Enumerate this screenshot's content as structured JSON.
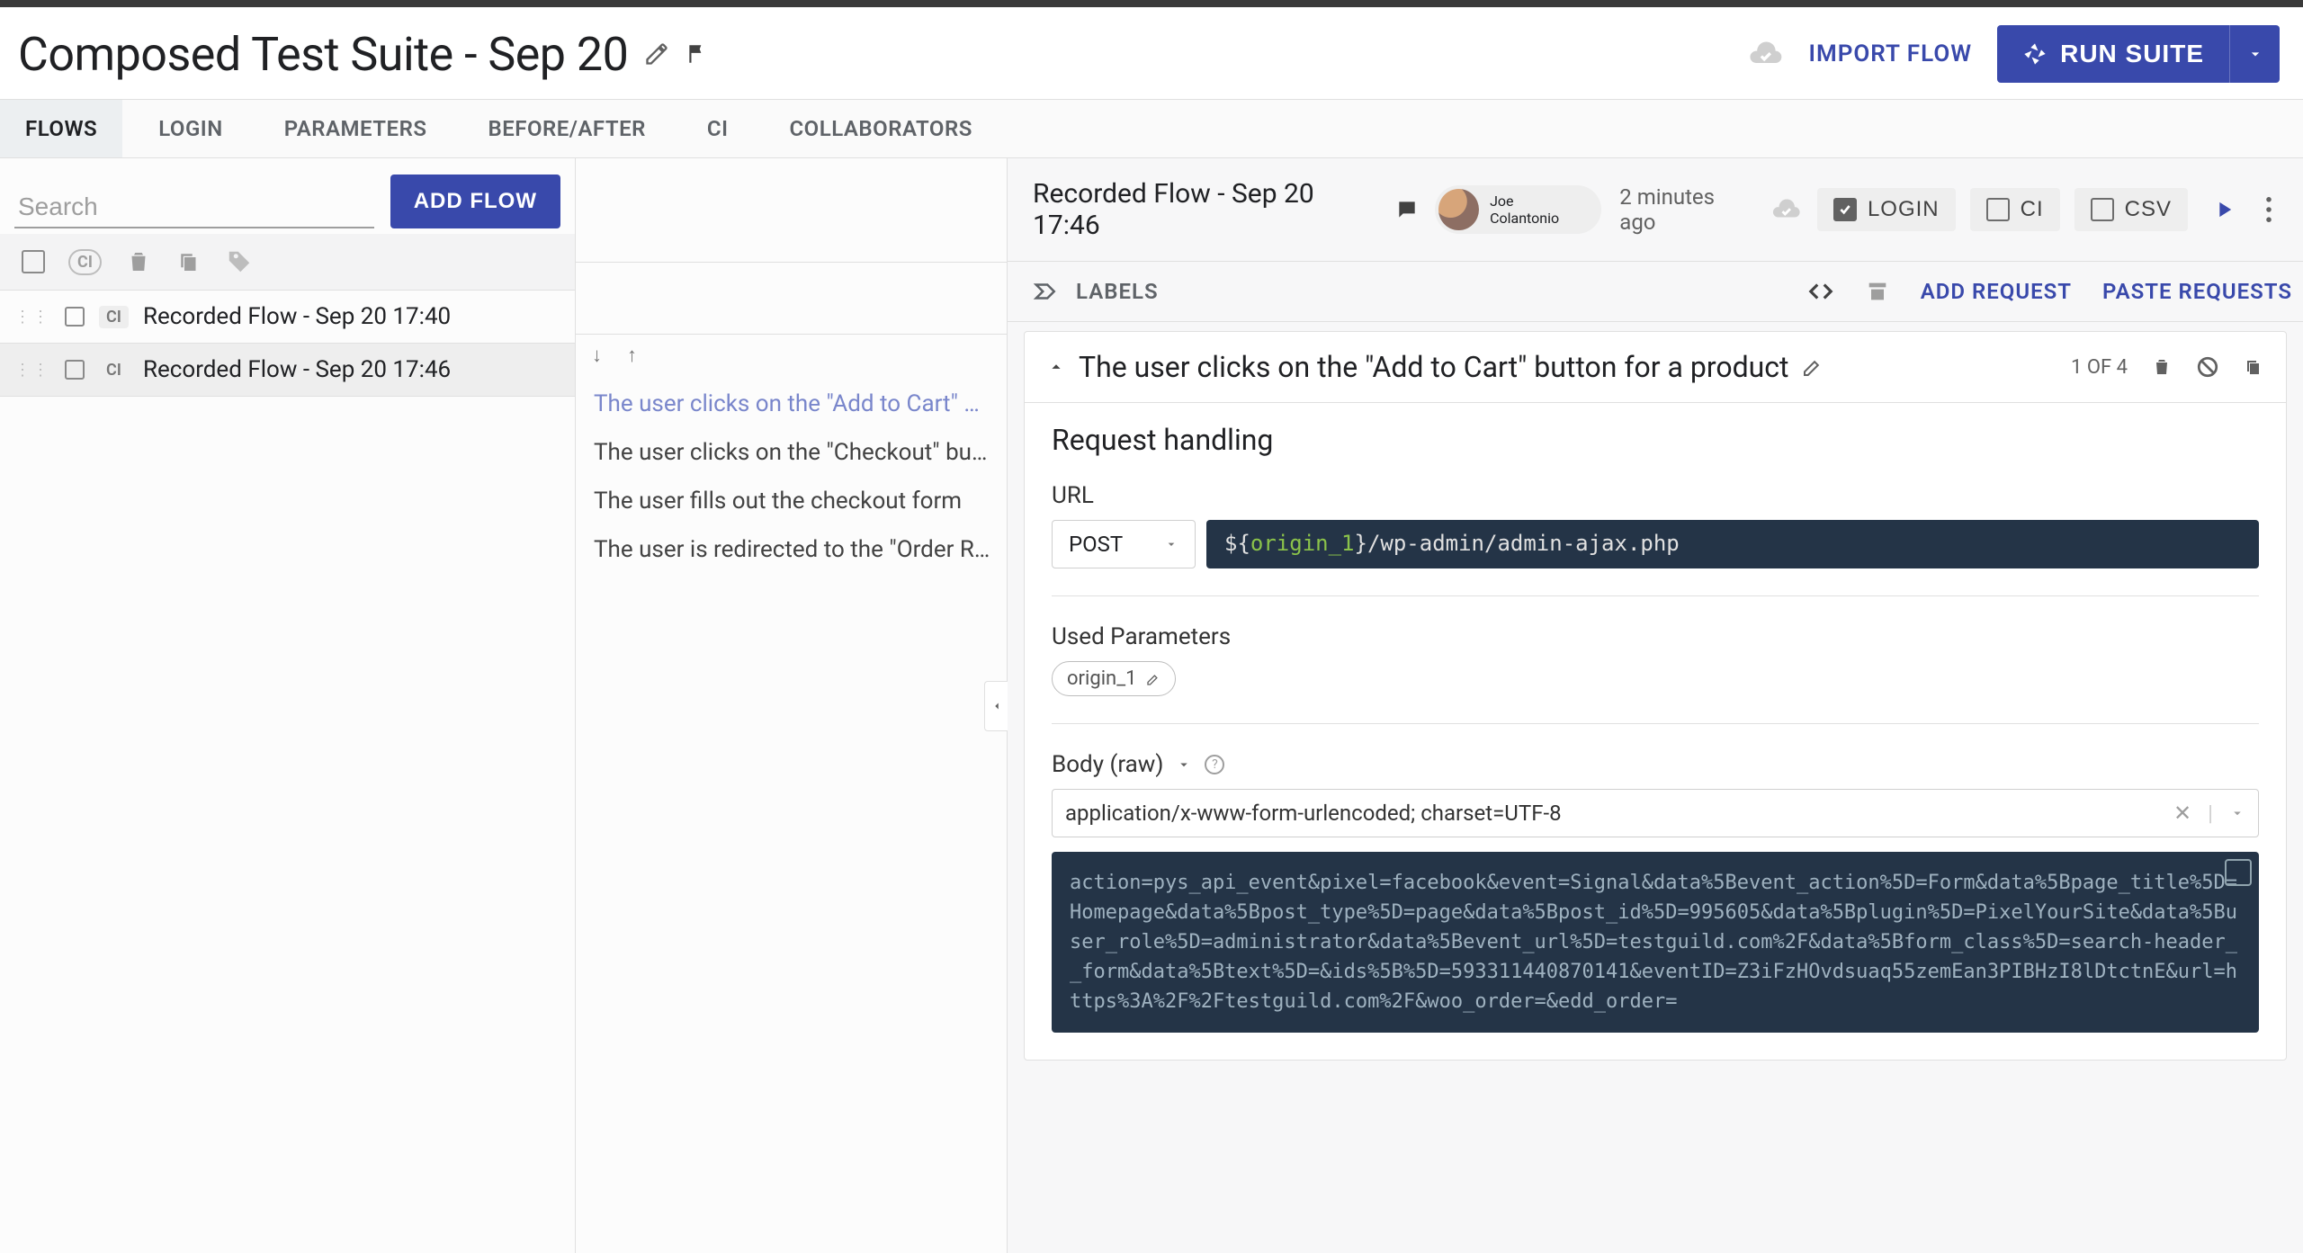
{
  "header": {
    "title": "Composed Test Suite - Sep 20",
    "import": "IMPORT FLOW",
    "run": "RUN SUITE"
  },
  "tabs": [
    "FLOWS",
    "LOGIN",
    "PARAMETERS",
    "BEFORE/AFTER",
    "CI",
    "COLLABORATORS"
  ],
  "sidebar": {
    "search_placeholder": "Search",
    "add_flow": "ADD FLOW",
    "flows": [
      {
        "ci": "CI",
        "name": "Recorded Flow - Sep 20 17:40",
        "active": false
      },
      {
        "ci": "CI",
        "name": "Recorded Flow - Sep 20 17:46",
        "active": true
      }
    ]
  },
  "flow": {
    "title": "Recorded Flow - Sep 20 17:46",
    "author": "Joe Colantonio",
    "timeago": "2 minutes ago",
    "toggles": {
      "login": "LOGIN",
      "ci": "CI",
      "csv": "CSV"
    }
  },
  "labels": {
    "label": "LABELS",
    "add_request": "ADD REQUEST",
    "paste_requests": "PASTE REQUESTS"
  },
  "steps": [
    "The user clicks on the \"Add to Cart\" button for a product",
    "The user clicks on the \"Checkout\" button",
    "The user fills out the checkout form",
    "The user is redirected to the \"Order Received\" page"
  ],
  "request": {
    "title": "The user clicks on the \"Add to Cart\" button for a product",
    "position": "1 OF 4",
    "section": "Request handling",
    "url_label": "URL",
    "method": "POST",
    "url_var": "origin_1",
    "url_path": "/wp-admin/admin-ajax.php",
    "used_params_label": "Used Parameters",
    "params": [
      "origin_1"
    ],
    "body_label": "Body (raw)",
    "content_type": "application/x-www-form-urlencoded; charset=UTF-8",
    "body_raw": "action=pys_api_event&pixel=facebook&event=Signal&data%5Bevent_action%5D=Form&data%5Bpage_title%5D=Homepage&data%5Bpost_type%5D=page&data%5Bpost_id%5D=995605&data%5Bplugin%5D=PixelYourSite&data%5Buser_role%5D=administrator&data%5Bevent_url%5D=testguild.com%2F&data%5Bform_class%5D=search-header__form&data%5Btext%5D=&ids%5B%5D=593311440870141&eventID=Z3iFzHOvdsuaq55zemEan3PIBHzI8lDtctnE&url=https%3A%2F%2Ftestguild.com%2F&woo_order=&edd_order="
  }
}
